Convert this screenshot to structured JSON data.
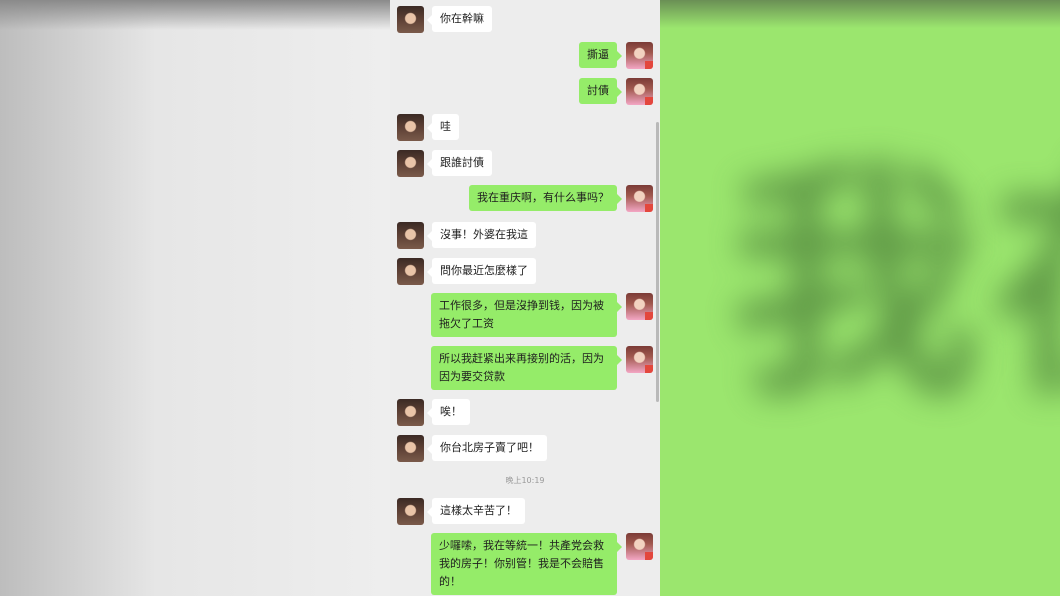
{
  "chat": {
    "messages": [
      {
        "side": "in",
        "text": "你在幹嘛"
      },
      {
        "side": "out",
        "text": "撕逼"
      },
      {
        "side": "out",
        "text": "討債"
      },
      {
        "side": "in",
        "text": "哇"
      },
      {
        "side": "in",
        "text": "跟誰討債"
      },
      {
        "side": "out",
        "text": "我在重庆啊，有什么事吗？"
      },
      {
        "side": "in",
        "text": "沒事！外婆在我這"
      },
      {
        "side": "in",
        "text": "問你最近怎麼樣了"
      },
      {
        "side": "out",
        "text": "工作很多，但是沒挣到钱，因为被拖欠了工资"
      },
      {
        "side": "out",
        "text": "所以我赶紧出来再接别的活，因为因为要交贷款"
      },
      {
        "side": "in",
        "text": "唉！"
      },
      {
        "side": "in",
        "text": "你台北房子賣了吧！"
      },
      {
        "side": "in",
        "text": "這樣太辛苦了！"
      },
      {
        "side": "out",
        "text": "少囉嗦，我在等統一！共產党会救我的房子！你别管！我是不会賠售的！"
      }
    ],
    "timestamp": "晚上10:19"
  },
  "background": {
    "right_blurred_text": "我在",
    "right_color": "#9be66e",
    "chat_bg_color": "#ededed",
    "outgoing_bubble_color": "#95ec69",
    "incoming_bubble_color": "#ffffff"
  }
}
